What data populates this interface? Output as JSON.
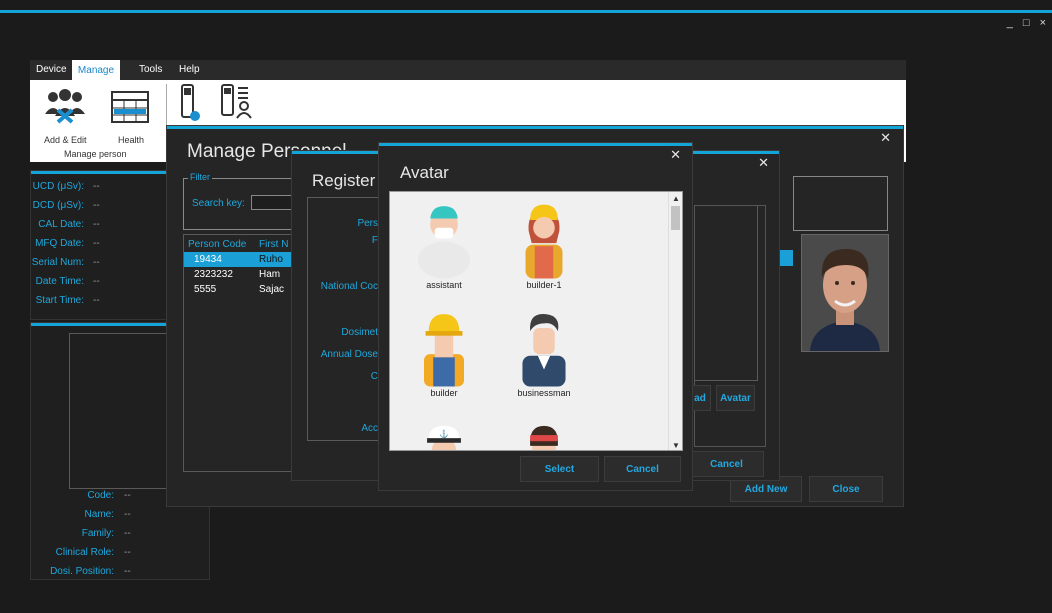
{
  "window": {
    "controls": [
      "_",
      "□",
      "×"
    ]
  },
  "menu": {
    "tabs": [
      "Device",
      "Manage",
      "Tools",
      "Help"
    ],
    "active": "Manage"
  },
  "ribbon": {
    "add_edit": "Add & Edit",
    "health": "Health",
    "group_label": "Manage person"
  },
  "device_panel": {
    "fields": [
      {
        "label": "UCD (μSv):",
        "value": "--"
      },
      {
        "label": "DCD (μSv):",
        "value": "--"
      },
      {
        "label": "CAL Date:",
        "value": "--"
      },
      {
        "label": "MFQ Date:",
        "value": "--"
      },
      {
        "label": "Serial Num:",
        "value": "--"
      },
      {
        "label": "Date Time:",
        "value": "--"
      },
      {
        "label": "Start Time:",
        "value": "--"
      }
    ]
  },
  "person_panel": {
    "fields": [
      {
        "label": "Code:",
        "value": "--"
      },
      {
        "label": "Name:",
        "value": "--"
      },
      {
        "label": "Family:",
        "value": "--"
      },
      {
        "label": "Clinical Role:",
        "value": "--"
      },
      {
        "label": "Dosi. Position:",
        "value": "--"
      }
    ]
  },
  "manage_dialog": {
    "title": "Manage Personnel",
    "filter_legend": "Filter",
    "search_label": "Search key:",
    "columns": [
      "Person Code",
      "First N"
    ],
    "rows": [
      {
        "code": "19434",
        "first": "Ruho"
      },
      {
        "code": "2323232",
        "first": "Ham"
      },
      {
        "code": "5555",
        "first": "Sajac"
      }
    ],
    "add_new": "Add New",
    "close": "Close"
  },
  "register_dialog": {
    "title": "Register",
    "labels": [
      "Pers",
      "F",
      "National Coc",
      "Dosimet",
      "Annual Dose",
      "C",
      "Acc"
    ],
    "upload": "ad",
    "avatar": "Avatar",
    "cancel": "Cancel"
  },
  "avatar_dialog": {
    "title": "Avatar",
    "items": [
      {
        "name": "assistant",
        "icon": "assistant-avatar-icon"
      },
      {
        "name": "builder-1",
        "icon": "builder-female-avatar-icon"
      },
      {
        "name": "builder",
        "icon": "builder-avatar-icon"
      },
      {
        "name": "businessman",
        "icon": "businessman-avatar-icon"
      },
      {
        "name": "",
        "icon": "captain-avatar-icon"
      },
      {
        "name": "",
        "icon": "headband-avatar-icon"
      }
    ],
    "select": "Select",
    "cancel": "Cancel"
  },
  "colors": {
    "accent": "#14a4d8",
    "bg": "#1b1b1b",
    "panel": "#252526",
    "label": "#1ea8dc"
  }
}
